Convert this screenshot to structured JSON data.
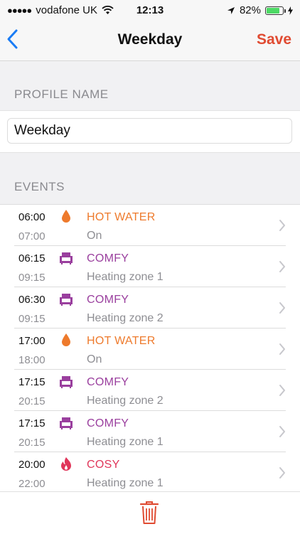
{
  "status_bar": {
    "carrier": "vodafone UK",
    "time": "12:13",
    "battery_percent": "82%",
    "battery_level": 0.82,
    "colors": {
      "battery": "#4cd964"
    }
  },
  "nav": {
    "back_icon": "chevron-left-icon",
    "title": "Weekday",
    "save_label": "Save",
    "colors": {
      "back": "#1a7cf5",
      "save": "#e04b32"
    }
  },
  "profile": {
    "header": "PROFILE NAME",
    "name_value": "Weekday"
  },
  "events_header": "EVENTS",
  "events": [
    {
      "start": "06:00",
      "end": "07:00",
      "type": "HOT WATER",
      "desc": "On",
      "icon": "water-drop-icon",
      "color": "#ee7a2c"
    },
    {
      "start": "06:15",
      "end": "09:15",
      "type": "COMFY",
      "desc": "Heating zone 1",
      "icon": "armchair-icon",
      "color": "#9a3f9e"
    },
    {
      "start": "06:30",
      "end": "09:15",
      "type": "COMFY",
      "desc": "Heating zone 2",
      "icon": "armchair-icon",
      "color": "#9a3f9e"
    },
    {
      "start": "17:00",
      "end": "18:00",
      "type": "HOT WATER",
      "desc": "On",
      "icon": "water-drop-icon",
      "color": "#ee7a2c"
    },
    {
      "start": "17:15",
      "end": "20:15",
      "type": "COMFY",
      "desc": "Heating zone 2",
      "icon": "armchair-icon",
      "color": "#9a3f9e"
    },
    {
      "start": "17:15",
      "end": "20:15",
      "type": "COMFY",
      "desc": "Heating zone 1",
      "icon": "armchair-icon",
      "color": "#9a3f9e"
    },
    {
      "start": "20:00",
      "end": "22:00",
      "type": "COSY",
      "desc": "Heating zone 1",
      "icon": "flame-icon",
      "color": "#e0365a"
    }
  ],
  "footer": {
    "delete_icon": "trash-icon",
    "color": "#e04b32"
  }
}
